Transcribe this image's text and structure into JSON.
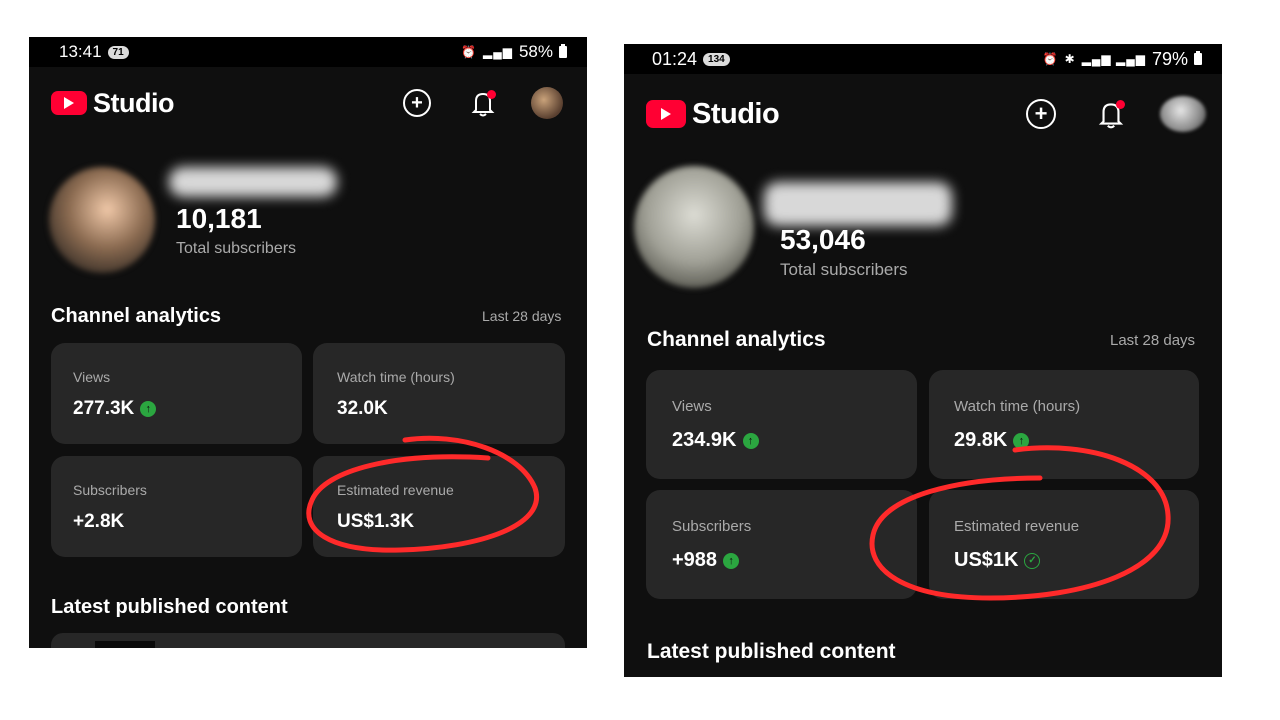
{
  "left": {
    "status": {
      "time": "13:41",
      "badge": "71",
      "battery": "58%"
    },
    "app": {
      "name": "Studio"
    },
    "channel": {
      "subscribers": "10,181",
      "subscribers_label": "Total subscribers"
    },
    "analytics": {
      "title": "Channel analytics",
      "range": "Last 28 days",
      "cards": [
        {
          "label": "Views",
          "value": "277.3K",
          "trend": "up"
        },
        {
          "label": "Watch time (hours)",
          "value": "32.0K",
          "trend": "none"
        },
        {
          "label": "Subscribers",
          "value": "+2.8K",
          "trend": "none"
        },
        {
          "label": "Estimated revenue",
          "value": "US$1.3K",
          "trend": "none"
        }
      ]
    },
    "latest_title": "Latest published content"
  },
  "right": {
    "status": {
      "time": "01:24",
      "badge": "134",
      "battery": "79%"
    },
    "app": {
      "name": "Studio"
    },
    "channel": {
      "subscribers": "53,046",
      "subscribers_label": "Total subscribers"
    },
    "analytics": {
      "title": "Channel analytics",
      "range": "Last 28 days",
      "cards": [
        {
          "label": "Views",
          "value": "234.9K",
          "trend": "up"
        },
        {
          "label": "Watch time (hours)",
          "value": "29.8K",
          "trend": "up"
        },
        {
          "label": "Subscribers",
          "value": "+988",
          "trend": "up"
        },
        {
          "label": "Estimated revenue",
          "value": "US$1K",
          "trend": "check"
        }
      ]
    },
    "latest_title": "Latest published content"
  },
  "colors": {
    "background": "#0f0f0f",
    "card": "#272727",
    "brand_red": "#ff0033",
    "trend_green": "#2ba640",
    "annotation": "#ff2a2a"
  },
  "icons": [
    "alarm-icon",
    "signal-icon",
    "battery-icon",
    "youtube-logo-icon",
    "plus-icon",
    "bell-icon",
    "avatar",
    "up-arrow-icon",
    "check-circle-icon"
  ]
}
